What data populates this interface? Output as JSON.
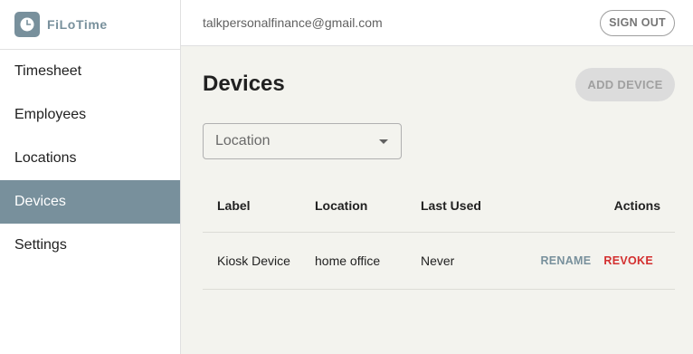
{
  "brand": {
    "name": "FiLoTime",
    "icon": "clock-icon"
  },
  "sidebar": {
    "items": [
      {
        "label": "Timesheet",
        "active": false
      },
      {
        "label": "Employees",
        "active": false
      },
      {
        "label": "Locations",
        "active": false
      },
      {
        "label": "Devices",
        "active": true
      },
      {
        "label": "Settings",
        "active": false
      }
    ]
  },
  "header": {
    "user_email": "talkpersonalfinance@gmail.com",
    "sign_out_label": "SIGN OUT"
  },
  "main": {
    "title": "Devices",
    "add_button_label": "ADD DEVICE",
    "add_button_disabled": true,
    "location_select": {
      "value": "Location"
    }
  },
  "table": {
    "columns": [
      "Label",
      "Location",
      "Last Used",
      "Actions"
    ],
    "rows": [
      {
        "label": "Kiosk Device",
        "location": "home office",
        "last_used": "Never",
        "actions": {
          "rename": "RENAME",
          "revoke": "REVOKE"
        }
      }
    ]
  },
  "colors": {
    "accent": "#78909c",
    "danger": "#d32f2f",
    "main_background": "#f3f3ee"
  }
}
